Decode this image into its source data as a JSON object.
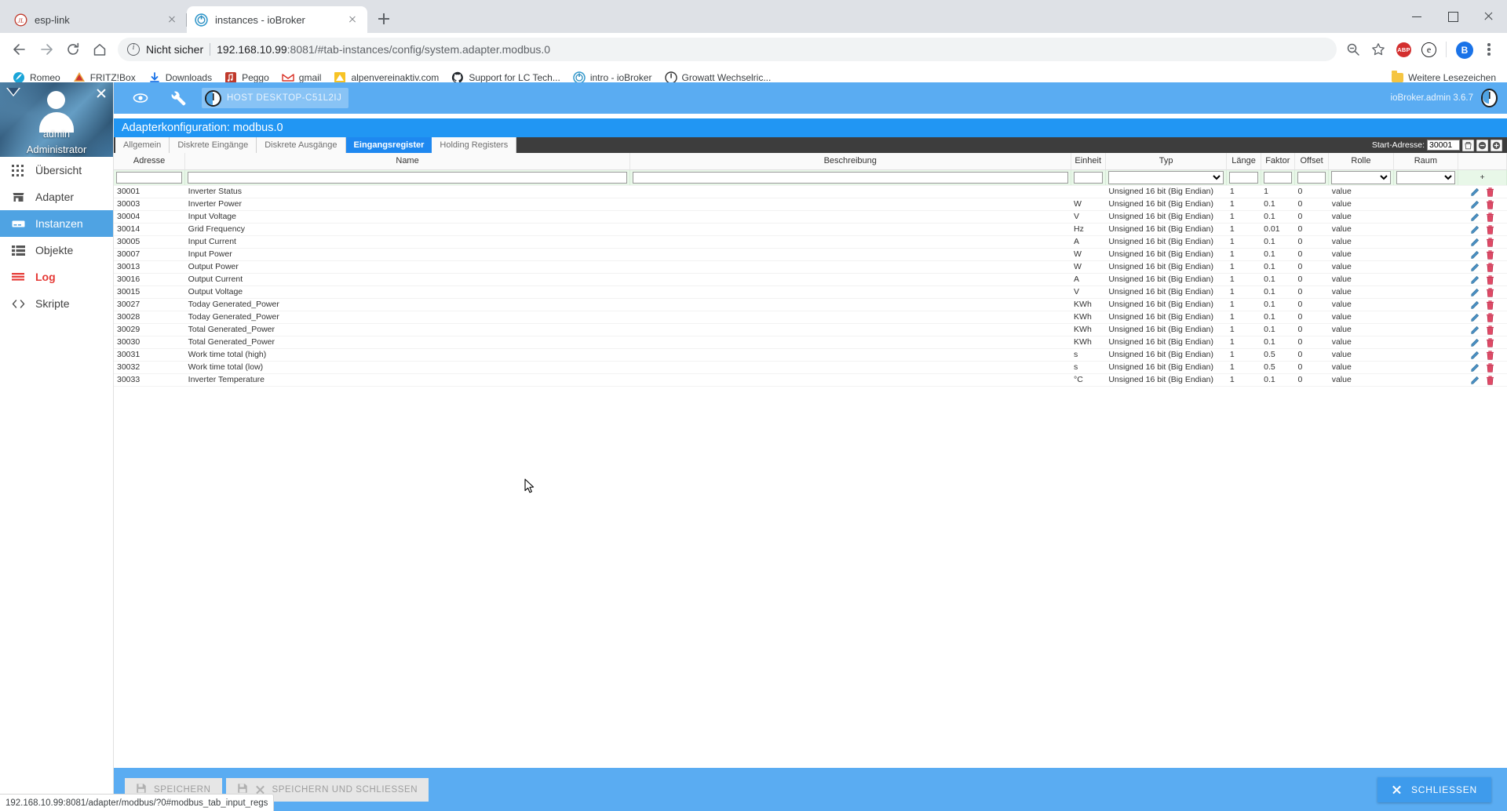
{
  "browser": {
    "tabs": [
      {
        "title": "esp-link",
        "favicon": "esp-link-icon",
        "active": false
      },
      {
        "title": "instances - ioBroker",
        "favicon": "iobroker-icon",
        "active": true
      }
    ],
    "new_tab_label": "+",
    "window_controls": {
      "minimize": "–",
      "maximize": "□",
      "close": "✕"
    },
    "nav": {
      "back": "back-arrow",
      "forward": "forward-arrow",
      "reload": "reload",
      "home": "home"
    },
    "omnibox": {
      "security_label": "Nicht sicher",
      "url_host": "192.168.10.99",
      "url_rest": ":8081/#tab-instances/config/system.adapter.modbus.0",
      "full_url": "192.168.10.99:8081/#tab-instances/config/system.adapter.modbus.0"
    },
    "omni_actions": {
      "zoom": "zoom-out-icon",
      "bookmark_star": "star-icon",
      "ext_abp": "ABP",
      "ext_e": "e",
      "profile": "B",
      "menu": "kebab-menu-icon"
    },
    "bookmarks": [
      {
        "label": "Romeo",
        "icon": "romeo-icon"
      },
      {
        "label": "FRITZ!Box",
        "icon": "fritzbox-icon"
      },
      {
        "label": "Downloads",
        "icon": "download-icon"
      },
      {
        "label": "Peggo",
        "icon": "peggo-icon"
      },
      {
        "label": "gmail",
        "icon": "gmail-icon"
      },
      {
        "label": "alpenvereinaktiv.com",
        "icon": "alpenverein-icon"
      },
      {
        "label": "Support for LC Tech...",
        "icon": "github-icon"
      },
      {
        "label": "intro - ioBroker",
        "icon": "iobroker-icon"
      },
      {
        "label": "Growatt Wechselric...",
        "icon": "growatt-icon"
      }
    ],
    "bookmarks_overflow": {
      "label": "Weitere Lesezeichen",
      "icon": "folder-icon"
    },
    "status_bar_url": "192.168.10.99:8081/adapter/modbus/?0#modbus_tab_input_regs"
  },
  "sidebar": {
    "user_name": "admin",
    "user_role": "Administrator",
    "collapse_icon": "caret-down-icon",
    "close_icon": "close-icon",
    "items": [
      {
        "label": "Übersicht",
        "icon": "grid-icon",
        "active": false
      },
      {
        "label": "Adapter",
        "icon": "shop-icon",
        "active": false
      },
      {
        "label": "Instanzen",
        "icon": "instances-icon",
        "active": true
      },
      {
        "label": "Objekte",
        "icon": "list-icon",
        "active": false
      },
      {
        "label": "Log",
        "icon": "log-icon",
        "active": false
      },
      {
        "label": "Skripte",
        "icon": "code-icon",
        "active": false
      }
    ]
  },
  "appbar": {
    "eye_icon": "eye-icon",
    "wrench_icon": "wrench-icon",
    "host_label": "HOST DESKTOP-C51L2IJ",
    "version_label": "ioBroker.admin 3.6.7",
    "logo_icon": "iobroker-logo-icon"
  },
  "config": {
    "title": "Adapterkonfiguration: modbus.0",
    "tabs": [
      {
        "label": "Allgemein",
        "selected": false
      },
      {
        "label": "Diskrete Eingänge",
        "selected": false
      },
      {
        "label": "Diskrete Ausgänge",
        "selected": false
      },
      {
        "label": "Eingangsregister",
        "selected": true
      },
      {
        "label": "Holding Registers",
        "selected": false
      }
    ],
    "start_address": {
      "label": "Start-Adresse:",
      "value": "30001",
      "delete_icon": "trash-icon",
      "minus_icon": "minus-circle-icon",
      "plus_icon": "plus-circle-icon"
    }
  },
  "table": {
    "columns": [
      "Adresse",
      "Name",
      "Beschreibung",
      "Einheit",
      "Typ",
      "Länge",
      "Faktor",
      "Offset",
      "Rolle",
      "Raum"
    ],
    "filter_row": {
      "adresse": "",
      "name": "",
      "beschreibung": "",
      "einheit": "",
      "typ": "",
      "laenge": "",
      "faktor": "",
      "offset": "",
      "rolle": "",
      "raum": "",
      "add_label": "+"
    },
    "row_icons": {
      "edit": "pencil-icon",
      "delete": "trash-icon"
    },
    "rows": [
      {
        "adresse": "30001",
        "name": "Inverter Status",
        "beschreibung": "",
        "einheit": "",
        "typ": "Unsigned 16 bit (Big Endian)",
        "laenge": "1",
        "faktor": "1",
        "offset": "0",
        "rolle": "value",
        "raum": ""
      },
      {
        "adresse": "30003",
        "name": "Inverter Power",
        "beschreibung": "",
        "einheit": "W",
        "typ": "Unsigned 16 bit (Big Endian)",
        "laenge": "1",
        "faktor": "0.1",
        "offset": "0",
        "rolle": "value",
        "raum": ""
      },
      {
        "adresse": "30004",
        "name": "Input Voltage",
        "beschreibung": "",
        "einheit": "V",
        "typ": "Unsigned 16 bit (Big Endian)",
        "laenge": "1",
        "faktor": "0.1",
        "offset": "0",
        "rolle": "value",
        "raum": ""
      },
      {
        "adresse": "30014",
        "name": "Grid Frequency",
        "beschreibung": "",
        "einheit": "Hz",
        "typ": "Unsigned 16 bit (Big Endian)",
        "laenge": "1",
        "faktor": "0.01",
        "offset": "0",
        "rolle": "value",
        "raum": ""
      },
      {
        "adresse": "30005",
        "name": "Input Current",
        "beschreibung": "",
        "einheit": "A",
        "typ": "Unsigned 16 bit (Big Endian)",
        "laenge": "1",
        "faktor": "0.1",
        "offset": "0",
        "rolle": "value",
        "raum": ""
      },
      {
        "adresse": "30007",
        "name": "Input Power",
        "beschreibung": "",
        "einheit": "W",
        "typ": "Unsigned 16 bit (Big Endian)",
        "laenge": "1",
        "faktor": "0.1",
        "offset": "0",
        "rolle": "value",
        "raum": ""
      },
      {
        "adresse": "30013",
        "name": "Output Power",
        "beschreibung": "",
        "einheit": "W",
        "typ": "Unsigned 16 bit (Big Endian)",
        "laenge": "1",
        "faktor": "0.1",
        "offset": "0",
        "rolle": "value",
        "raum": ""
      },
      {
        "adresse": "30016",
        "name": "Output Current",
        "beschreibung": "",
        "einheit": "A",
        "typ": "Unsigned 16 bit (Big Endian)",
        "laenge": "1",
        "faktor": "0.1",
        "offset": "0",
        "rolle": "value",
        "raum": ""
      },
      {
        "adresse": "30015",
        "name": "Output Voltage",
        "beschreibung": "",
        "einheit": "V",
        "typ": "Unsigned 16 bit (Big Endian)",
        "laenge": "1",
        "faktor": "0.1",
        "offset": "0",
        "rolle": "value",
        "raum": ""
      },
      {
        "adresse": "30027",
        "name": "Today Generated_Power",
        "beschreibung": "",
        "einheit": "KWh",
        "typ": "Unsigned 16 bit (Big Endian)",
        "laenge": "1",
        "faktor": "0.1",
        "offset": "0",
        "rolle": "value",
        "raum": ""
      },
      {
        "adresse": "30028",
        "name": "Today Generated_Power",
        "beschreibung": "",
        "einheit": "KWh",
        "typ": "Unsigned 16 bit (Big Endian)",
        "laenge": "1",
        "faktor": "0.1",
        "offset": "0",
        "rolle": "value",
        "raum": ""
      },
      {
        "adresse": "30029",
        "name": "Total Generated_Power",
        "beschreibung": "",
        "einheit": "KWh",
        "typ": "Unsigned 16 bit (Big Endian)",
        "laenge": "1",
        "faktor": "0.1",
        "offset": "0",
        "rolle": "value",
        "raum": ""
      },
      {
        "adresse": "30030",
        "name": "Total Generated_Power",
        "beschreibung": "",
        "einheit": "KWh",
        "typ": "Unsigned 16 bit (Big Endian)",
        "laenge": "1",
        "faktor": "0.1",
        "offset": "0",
        "rolle": "value",
        "raum": ""
      },
      {
        "adresse": "30031",
        "name": "Work time total (high)",
        "beschreibung": "",
        "einheit": "s",
        "typ": "Unsigned 16 bit (Big Endian)",
        "laenge": "1",
        "faktor": "0.5",
        "offset": "0",
        "rolle": "value",
        "raum": ""
      },
      {
        "adresse": "30032",
        "name": "Work time total (low)",
        "beschreibung": "",
        "einheit": "s",
        "typ": "Unsigned 16 bit (Big Endian)",
        "laenge": "1",
        "faktor": "0.5",
        "offset": "0",
        "rolle": "value",
        "raum": ""
      },
      {
        "adresse": "30033",
        "name": "Inverter Temperature",
        "beschreibung": "",
        "einheit": "°C",
        "typ": "Unsigned 16 bit (Big Endian)",
        "laenge": "1",
        "faktor": "0.1",
        "offset": "0",
        "rolle": "value",
        "raum": ""
      }
    ]
  },
  "footer": {
    "save_label": "SPEICHERN",
    "save_close_label": "SPEICHERN UND SCHLIESSEN",
    "close_label": "SCHLIESSEN",
    "save_icon": "save-icon",
    "close_icon": "close-icon"
  },
  "colors": {
    "accent": "#2196f3",
    "appbar": "#5aacf2",
    "sidebar_active": "#4fa3e3",
    "log_red": "#e53935",
    "filter_green": "#e8f7e8",
    "tabbar_dark": "#3d3d3d"
  }
}
